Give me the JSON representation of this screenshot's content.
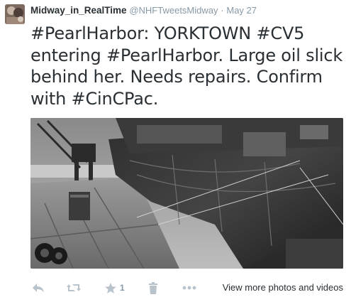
{
  "tweet": {
    "fullname": "Midway_in_RealTime",
    "username": "@NHFTweetsMidway",
    "separator": "·",
    "time": "May 27",
    "text_line1": "#PearlHarbor: YORKTOWN #CV5",
    "text_line2": "entering #PearlHarbor. Large oil slick",
    "text_line3": "behind her. Needs repairs. Confirm",
    "text_line4": "with #CinCPac.",
    "favorite_count": "1",
    "more_link": "View more photos and videos"
  },
  "icons": {
    "reply": "reply-icon",
    "retweet": "retweet-icon",
    "favorite": "star-icon",
    "delete": "trash-icon",
    "more": "more-dots-icon"
  },
  "colors": {
    "text": "#292f33",
    "muted": "#8899a6",
    "action_icon": "#b8c3cc"
  }
}
